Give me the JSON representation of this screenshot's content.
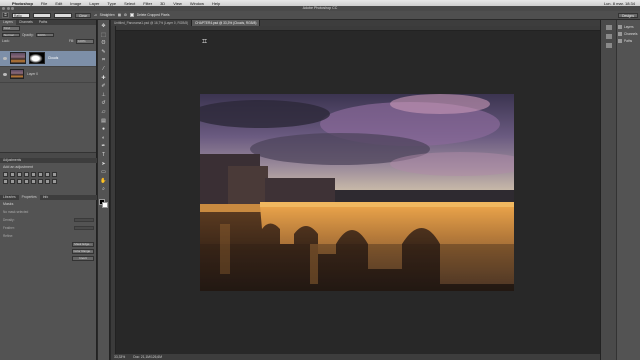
{
  "menubar": {
    "app_name": "Photoshop",
    "items": [
      "File",
      "Edit",
      "Image",
      "Layer",
      "Type",
      "Select",
      "Filter",
      "3D",
      "View",
      "Window",
      "Help"
    ],
    "status": "Lun. 8 mar. 18:34"
  },
  "window": {
    "title": "Adobe Photoshop CC"
  },
  "options": {
    "ratio": "Ratio",
    "clear": "Clear",
    "straighten": "Straighten",
    "delete_cropped": "Delete Cropped Pixels",
    "essentials": "Designs"
  },
  "doc_tabs": [
    "Untitled_Panorama1.psd @ 16,7% (Layer 0, RGB/8)",
    "CHAPTER4.psd @ 33,3% (Clouds, RGB/8)"
  ],
  "layers_panel": {
    "tabs": [
      "Layers",
      "Channels",
      "Paths"
    ],
    "kind": "Kind",
    "blend": "Normal",
    "opacity_label": "Opacity:",
    "opacity_value": "100%",
    "lock_label": "Lock:",
    "fill_label": "Fill:",
    "fill_value": "100%",
    "layers": [
      {
        "name": "Clouds",
        "selected": true
      },
      {
        "name": "Layer 0",
        "selected": false
      }
    ]
  },
  "adjustments_panel": {
    "tabs": [
      "Adjustments"
    ],
    "title": "Add an adjustment"
  },
  "properties_panel": {
    "tabs": [
      "Libraries",
      "Properties",
      "Info"
    ],
    "section": "Masks",
    "subtitle": "No mask selected",
    "density": "Density:",
    "feather": "Feather:",
    "refine": "Refine:",
    "btn_mask_edge": "Mask Edge...",
    "btn_color_range": "Color Range...",
    "btn_invert": "Invert"
  },
  "status_bar": {
    "zoom": "33,33%",
    "doc": "Doc: 21,1M/126,6M"
  },
  "right_panel": {
    "items": [
      "Layers",
      "Channels",
      "Paths"
    ]
  }
}
